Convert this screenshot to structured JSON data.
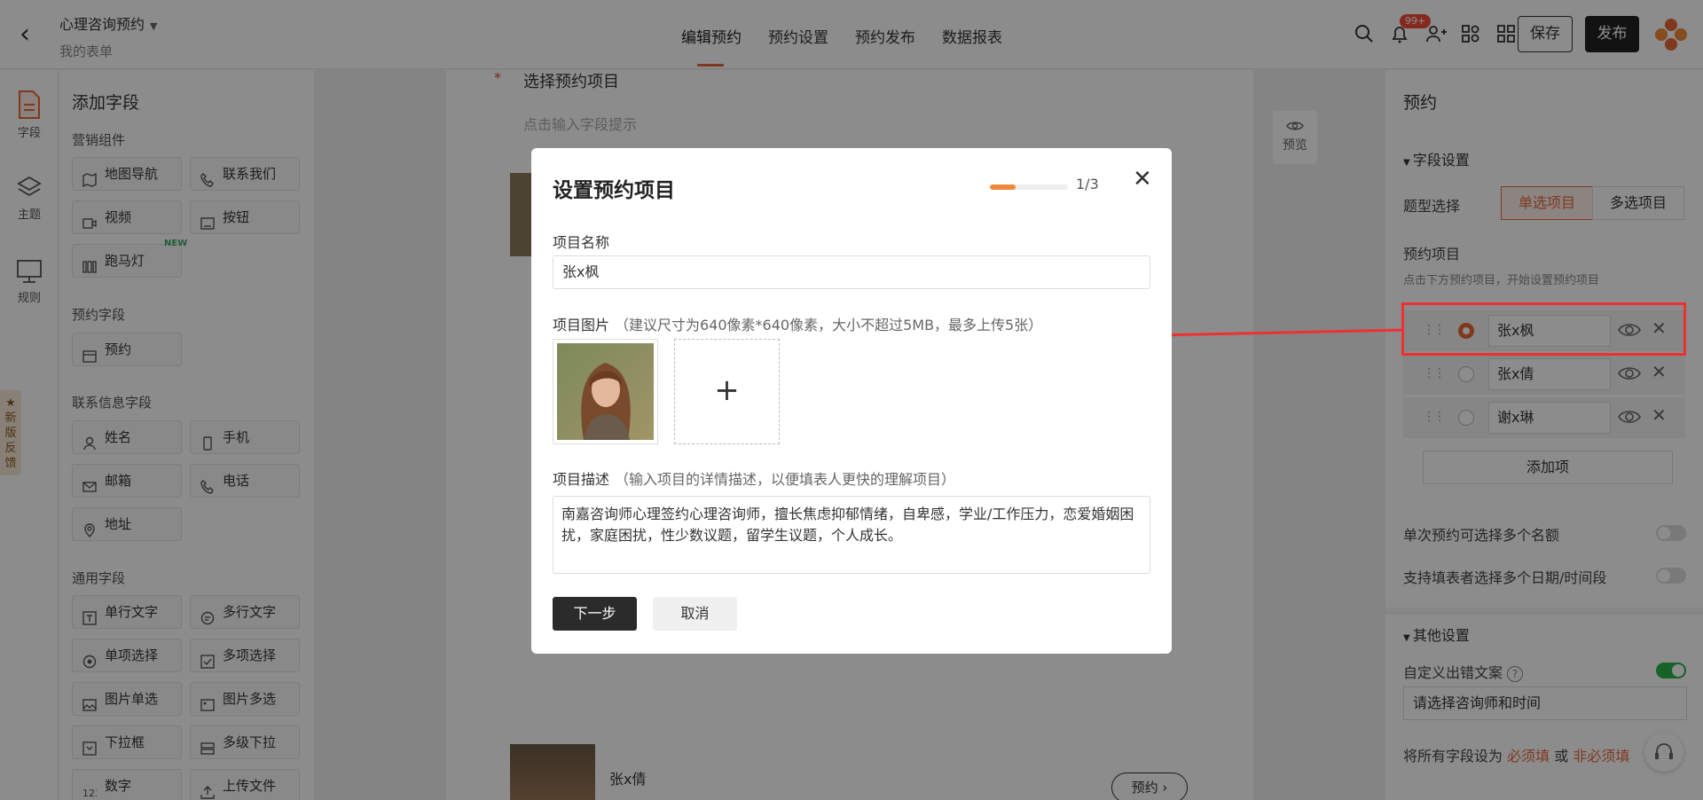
{
  "header": {
    "form_title": "心理咨询预约",
    "form_sub": "我的表单",
    "tabs": [
      {
        "label": "编辑预约"
      },
      {
        "label": "预约设置"
      },
      {
        "label": "预约发布"
      },
      {
        "label": "数据报表"
      }
    ],
    "notification_count": "99+",
    "save_label": "保存",
    "publish_label": "发布"
  },
  "left_rail": {
    "items": [
      {
        "label": "字段"
      },
      {
        "label": "主题"
      },
      {
        "label": "规则"
      }
    ],
    "feedback": "新版反馈"
  },
  "field_panel": {
    "title": "添加字段",
    "sections": [
      {
        "title": "营销组件",
        "items": [
          "地图导航",
          "联系我们",
          "视频",
          "按钮",
          "跑马灯"
        ]
      },
      {
        "title": "预约字段",
        "items": [
          "预约"
        ]
      },
      {
        "title": "联系信息字段",
        "items": [
          "姓名",
          "手机",
          "邮箱",
          "电话",
          "地址"
        ]
      },
      {
        "title": "通用字段",
        "items": [
          "单行文字",
          "多行文字",
          "单项选择",
          "多项选择",
          "图片单选",
          "图片多选",
          "下拉框",
          "多级下拉",
          "数字",
          "上传文件"
        ]
      }
    ],
    "new_tag": "NEW"
  },
  "canvas": {
    "question": "选择预约项目",
    "hint": "点击输入字段提示",
    "preview_label": "预览",
    "item2_name": "张x倩",
    "item2_btn": "预约"
  },
  "right_panel": {
    "title": "预约",
    "field_settings": "字段设置",
    "type_label": "题型选择",
    "type_single": "单选项目",
    "type_multi": "多选项目",
    "items_label": "预约项目",
    "items_hint": "点击下方预约项目，开始设置预约项目",
    "options": [
      {
        "value": "张x枫"
      },
      {
        "value": "张x倩"
      },
      {
        "value": "谢x琳"
      }
    ],
    "add_option": "添加项",
    "multi_quota": "单次预约可选择多个名额",
    "multi_time": "支持填表者选择多个日期/时间段",
    "other_settings": "其他设置",
    "custom_error": "自定义出错文案",
    "error_text": "请选择咨询师和时间",
    "foot_prefix": "将所有字段设为",
    "foot_required": "必须填",
    "foot_or": "或",
    "foot_optional": "非必须填"
  },
  "modal": {
    "title": "设置预约项目",
    "step": "1/3",
    "progress": 0.33,
    "name_label": "项目名称",
    "name_value": "张x枫",
    "image_label": "项目图片",
    "image_hint": "（建议尺寸为640像素*640像素，大小不超过5MB，最多上传5张）",
    "desc_label": "项目描述",
    "desc_hint": "（输入项目的详情描述，以便填表人更快的理解项目）",
    "desc_value": "南嘉咨询师心理签约心理咨询师，擅长焦虑抑郁情绪，自卑感，学业/工作压力，恋爱婚姻困扰，家庭困扰，性少数议题，留学生议题，个人成长。",
    "next_label": "下一步",
    "cancel_label": "取消"
  }
}
